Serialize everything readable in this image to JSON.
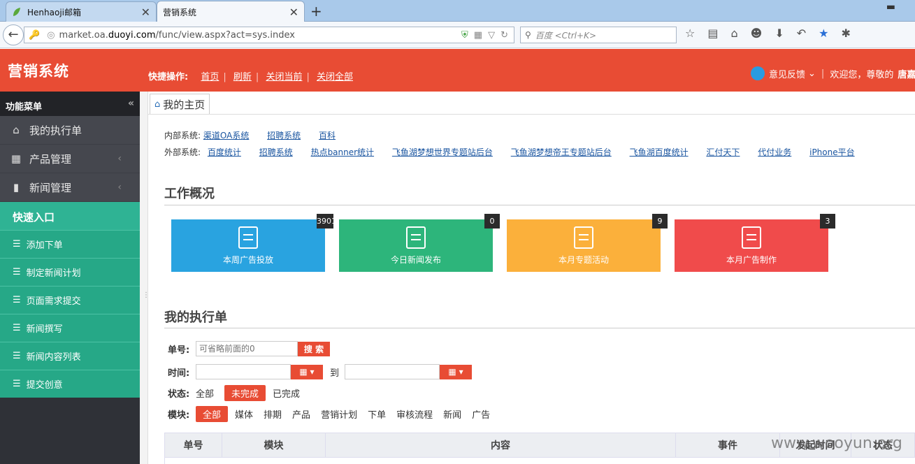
{
  "browser": {
    "tabs": [
      {
        "title": "Henhaoji邮箱",
        "active": false
      },
      {
        "title": "营销系统",
        "active": true
      }
    ],
    "url_prefix": "market.oa.",
    "url_domain": "duoyi.com",
    "url_path": "/func/view.aspx?act=sys.index",
    "search_placeholder": "百度 <Ctrl+K>"
  },
  "header": {
    "logo": "营销系统",
    "quick_label": "快捷操作:",
    "quick_links": [
      "首页",
      "刷新",
      "关闭当前",
      "关闭全部"
    ],
    "feedback": "意见反馈",
    "welcome": "欢迎您，尊敬的",
    "username": "唐嘉琪"
  },
  "sidebar": {
    "title": "功能菜单",
    "items": [
      {
        "label": "我的执行单",
        "icon": "home-icon"
      },
      {
        "label": "产品管理",
        "icon": "grid-icon"
      },
      {
        "label": "新闻管理",
        "icon": "document-icon"
      }
    ],
    "quick_title": "快速入口",
    "quick_items": [
      "添加下单",
      "制定新闻计划",
      "页面需求提交",
      "新闻撰写",
      "新闻内容列表",
      "提交创意"
    ]
  },
  "main": {
    "page_tab": "我的主页",
    "internal_label": "内部系统:",
    "internal_links": [
      "渠道OA系统",
      "招聘系统",
      "百科"
    ],
    "external_label": "外部系统:",
    "external_links": [
      "百度统计",
      "招聘系统",
      "热点banner统计",
      "飞鱼湖梦想世界专题站后台",
      "飞鱼湖梦想帝王专题站后台",
      "飞鱼湖百度统计",
      "汇付天下",
      "代付业务",
      "iPhone平台"
    ],
    "overview_title": "工作概况",
    "cards": [
      {
        "label": "本周广告投放",
        "count": "3901",
        "color": "#29a3e0"
      },
      {
        "label": "今日新闻发布",
        "count": "0",
        "color": "#2db57b"
      },
      {
        "label": "本月专题活动",
        "count": "9",
        "color": "#fbb03b"
      },
      {
        "label": "本月广告制作",
        "count": "3",
        "color": "#f04b4b"
      }
    ],
    "orders_title": "我的执行单",
    "filter": {
      "order_label": "单号:",
      "order_placeholder": "可省略前面的0",
      "search_btn": "搜 索",
      "time_label": "时间:",
      "to_label": "到",
      "status_label": "状态:",
      "status_options": [
        "全部",
        "未完成",
        "已完成"
      ],
      "status_selected": "未完成",
      "module_label": "模块:",
      "module_options": [
        "全部",
        "媒体",
        "排期",
        "产品",
        "营销计划",
        "下单",
        "审核流程",
        "新闻",
        "广告"
      ],
      "module_selected": "全部"
    },
    "table_headers": [
      "单号",
      "模块",
      "内容",
      "事件",
      "发起时间",
      "状态"
    ]
  },
  "watermark": "www.wooyun.org"
}
